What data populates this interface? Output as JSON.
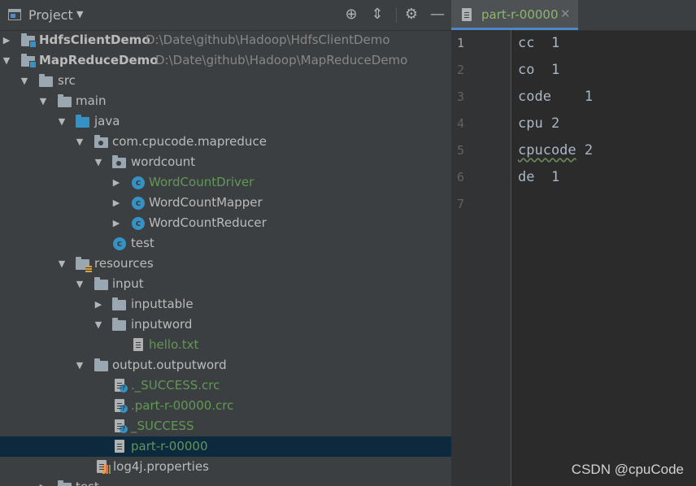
{
  "project_panel": {
    "title": "Project",
    "toolbar_icons": [
      "locate-icon",
      "collapse-all-icon",
      "settings-gear-icon",
      "hide-panel-icon"
    ],
    "tree": [
      {
        "label": "HdfsClientDemo",
        "path": "D:\\Date\\github\\Hadoop\\HdfsClientDemo"
      },
      {
        "label": "MapReduceDemo",
        "path": "D:\\Date\\github\\Hadoop\\MapReduceDemo"
      },
      {
        "label": "src"
      },
      {
        "label": "main"
      },
      {
        "label": "java"
      },
      {
        "label": "com.cpucode.mapreduce"
      },
      {
        "label": "wordcount"
      },
      {
        "label": "WordCountDriver"
      },
      {
        "label": "WordCountMapper"
      },
      {
        "label": "WordCountReducer"
      },
      {
        "label": "test"
      },
      {
        "label": "resources"
      },
      {
        "label": "input"
      },
      {
        "label": "inputtable"
      },
      {
        "label": "inputword"
      },
      {
        "label": "hello.txt"
      },
      {
        "label": "output.outputword"
      },
      {
        "label": "._SUCCESS.crc"
      },
      {
        "label": ".part-r-00000.crc"
      },
      {
        "label": "_SUCCESS"
      },
      {
        "label": "part-r-00000"
      },
      {
        "label": "log4j.properties"
      },
      {
        "label": "test"
      }
    ]
  },
  "editor": {
    "tab_label": "part-r-00000",
    "line_numbers": [
      "1",
      "2",
      "3",
      "4",
      "5",
      "6",
      "7"
    ],
    "lines": [
      "cc  1",
      "co  1",
      "code    1",
      "cpu 2",
      "cpucode 2",
      "de  1",
      ""
    ]
  },
  "watermark": "CSDN @cpuCode",
  "colors": {
    "panel_bg": "#3c3f41",
    "editor_bg": "#2b2b2b",
    "selection": "#0d293e",
    "vcs_added_green": "#629755",
    "class_icon_blue": "#3592c4"
  }
}
